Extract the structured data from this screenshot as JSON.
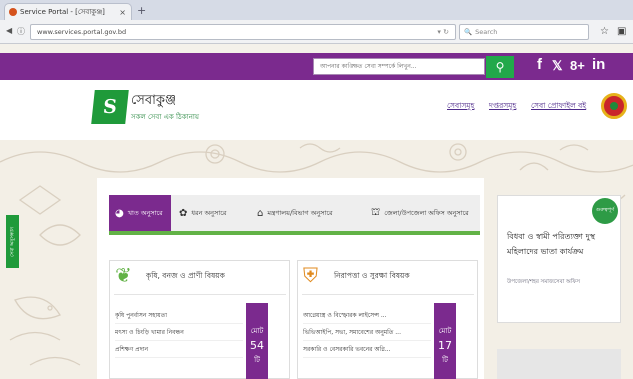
{
  "browser": {
    "tab_title": "Service Portal - [সেবাকুঞ্জ]",
    "url": "www.services.portal.gov.bd",
    "search_placeholder": "Search"
  },
  "site": {
    "search_placeholder": "আপনার কাঙ্ক্ষিত সেবা সম্পর্কে লিখুন...",
    "name": "সেবাকুঞ্জ",
    "tagline": "সকল সেবা এক ঠিকানায়",
    "nav_links": [
      "সেবাসমূহ",
      "দপ্তরসমূহ",
      "সেবা প্রোফাইল বই"
    ],
    "social": [
      "f",
      "𝕏",
      "8+",
      "in"
    ],
    "side_tab_label": "সেবা অনুসন্ধান"
  },
  "service_tabs": [
    {
      "label": "খাত অনুসারে",
      "icon": "pie-chart-icon"
    },
    {
      "label": "ধরন অনুসারে",
      "icon": "flower-icon"
    },
    {
      "label": "মন্ত্রণালয়/বিভাগ অনুসারে",
      "icon": "building-icon"
    },
    {
      "label": "জেলা/উপজেলা অফিস অনুসারে",
      "icon": "office-icon"
    }
  ],
  "panels": [
    {
      "title": "কৃষি, বনজ ও প্রাণী বিষয়ক",
      "icon": "leaf-icon",
      "items": [
        "কৃষি পুনর্বাসন সহায়তা",
        "মৎস্য ও চিংড়ি খামার নিবন্ধন",
        "প্রশিক্ষণ প্রদান"
      ],
      "count_label": "মোট",
      "count": "54",
      "count_unit": "টি"
    },
    {
      "title": "নিরাপত্তা ও সুরক্ষা বিষয়ক",
      "icon": "shield-icon",
      "items": [
        "আগ্নেয়াস্ত্র ও বিস্ফোরক লাইসেন্স ...",
        "ভিভিআইপি, সভা, সমাবেশের অনুমতি ...",
        "সরকারি ও বেসরকারি ভবনের অগ্নি..."
      ],
      "count_label": "মোট",
      "count": "17",
      "count_unit": "টি"
    }
  ],
  "highlight": {
    "badge": "গুরুত্বপূর্ণ",
    "title": "বিধবা ও স্বামী পরিত্যক্তা দুস্থ মহিলাদের ভাতা কার্যক্রম",
    "subtitle": "উপজেলা/শহর সমাজসেবা অফিস"
  },
  "colors": {
    "brand_purple": "#7b2a8e",
    "brand_green": "#1f9a3a",
    "search_green": "#22a84a"
  }
}
